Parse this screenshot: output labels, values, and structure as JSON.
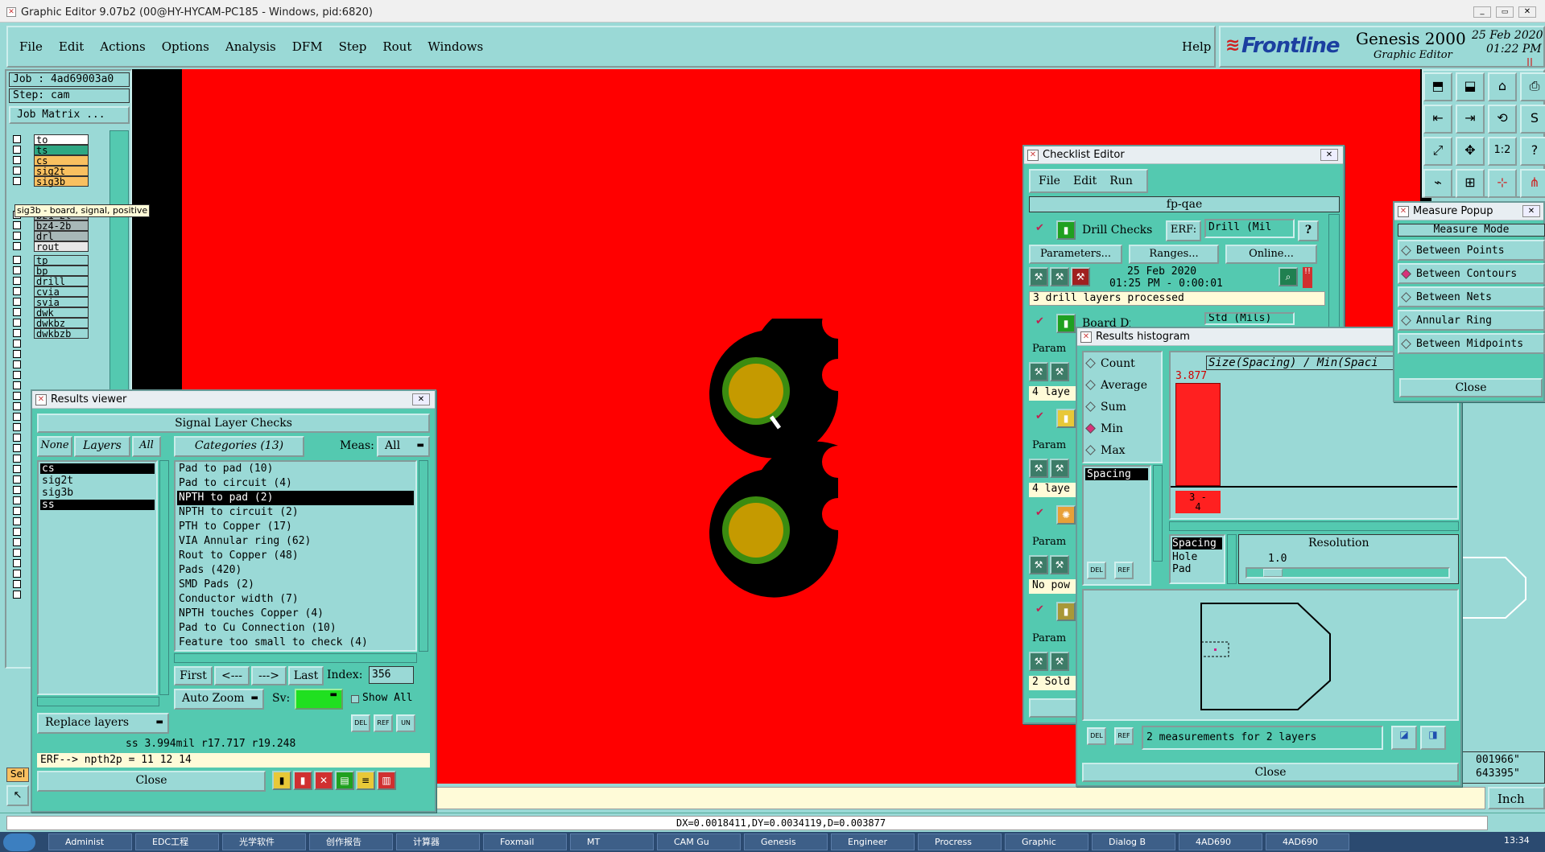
{
  "titlebar": {
    "title": "Graphic Editor 9.07b2 (00@HY-HYCAM-PC185 - Windows, pid:6820)"
  },
  "menu": {
    "items": [
      "File",
      "Edit",
      "Actions",
      "Options",
      "Analysis",
      "DFM",
      "Step",
      "Rout",
      "Windows"
    ],
    "help": "Help"
  },
  "brand": {
    "logo": "Frontline",
    "product": "Genesis 2000",
    "subtitle": "Graphic Editor",
    "date": "25 Feb 2020",
    "time": "01:22 PM"
  },
  "job": {
    "job_label": "Job : 4ad69003a0",
    "step_label": "Step: cam",
    "matrix_button": "Job Matrix ..."
  },
  "layers": [
    {
      "name": "to",
      "color": "#ffffff"
    },
    {
      "name": "ts",
      "color": "#2ea783"
    },
    {
      "name": "cs",
      "color": "#f9c060"
    },
    {
      "name": "sig2t",
      "color": "#f9c060"
    },
    {
      "name": "sig3b",
      "color": "#f9c060"
    },
    {
      "name": "bz1-2t",
      "color": "#a8b8b8"
    },
    {
      "name": "bz4-2b",
      "color": "#a8b8b8"
    },
    {
      "name": "drl",
      "color": "#a8b8b8"
    },
    {
      "name": "rout",
      "color": "#e8e8e8"
    },
    {
      "name": "tp",
      "color": "#9ad9d6"
    },
    {
      "name": "bp",
      "color": "#9ad9d6"
    },
    {
      "name": "drill",
      "color": "#9ad9d6"
    },
    {
      "name": "cvia",
      "color": "#9ad9d6"
    },
    {
      "name": "svia",
      "color": "#9ad9d6"
    },
    {
      "name": "dwk",
      "color": "#9ad9d6"
    },
    {
      "name": "dwkbz",
      "color": "#9ad9d6"
    },
    {
      "name": "dwkbzb",
      "color": "#9ad9d6"
    }
  ],
  "layer_tooltip": "sig3b - board, signal, positive",
  "results_viewer": {
    "title": "Results viewer",
    "header": "Signal Layer Checks",
    "none_btn": "None",
    "layers_btn": "Layers",
    "all_btn": "All",
    "categories_btn": "Categories (13)",
    "meas_label": "Meas:",
    "meas_value": "All",
    "layer_list": [
      "cs",
      "sig2t",
      "sig3b",
      "ss"
    ],
    "categories": [
      "Pad to pad (10)",
      "Pad to circuit (4)",
      "NPTH to pad (2)",
      "NPTH to circuit (2)",
      "PTH to Copper (17)",
      "VIA Annular ring (62)",
      "Rout to Copper (48)",
      "Pads (420)",
      "SMD Pads (2)",
      "Conductor width (7)",
      "NPTH touches Copper (4)",
      "Pad to Cu Connection (10)",
      "Feature too small to check (4)"
    ],
    "first_btn": "First",
    "prev_btn": "<---",
    "next_btn": "--->",
    "last_btn": "Last",
    "index_label": "Index:",
    "index_value": "356",
    "zoom_btn": "Auto Zoom",
    "sv_label": "Sv:",
    "show_all": "Show All",
    "replace_btn": "Replace layers",
    "status": "ss 3.994mil  r17.717  r19.248",
    "erf": "ERF--> npth2p = 11 12 14",
    "close": "Close"
  },
  "checklist": {
    "title": "Checklist Editor",
    "menu": [
      "File",
      "Edit",
      "Run"
    ],
    "name": "fp-qae",
    "drill": {
      "label": "Drill Checks",
      "erf_label": "ERF:",
      "erf_value": "Drill (Mil",
      "params": "Parameters...",
      "ranges": "Ranges...",
      "online": "Online...",
      "date": "25 Feb 2020",
      "time": "01:25 PM - 0:00:01",
      "status": "3 drill layers processed"
    },
    "board_drill": {
      "label": "Board Drill Ch",
      "erf_value": "Std (Mils)"
    },
    "partial": [
      "Param",
      "4 laye",
      "Param",
      "4 laye",
      "Param",
      "No pow",
      "Param",
      "2 Sold"
    ]
  },
  "histogram": {
    "title": "Results histogram",
    "modes": [
      {
        "label": "Count",
        "on": false
      },
      {
        "label": "Average",
        "on": false
      },
      {
        "label": "Sum",
        "on": false
      },
      {
        "label": "Min",
        "on": true
      },
      {
        "label": "Max",
        "on": false
      }
    ],
    "attr_list": [
      "Spacing"
    ],
    "chart_title": "Size(Spacing) / Min(Spaci",
    "bar_value": "3.877",
    "bin_label": "3 - 4",
    "list": [
      "Spacing",
      "Hole",
      "Pad"
    ],
    "resolution_label": "Resolution",
    "resolution_value": "1.0",
    "measurements": "2 measurements for 2 layers",
    "close": "Close"
  },
  "measure": {
    "title": "Measure Popup",
    "header": "Measure Mode",
    "options": [
      {
        "label": "Between Points",
        "on": false
      },
      {
        "label": "Between Contours",
        "on": true
      },
      {
        "label": "Between Nets",
        "on": false
      },
      {
        "label": "Annular Ring",
        "on": false
      },
      {
        "label": "Between Midpoints",
        "on": false
      }
    ],
    "close": "Close"
  },
  "coords": {
    "line1": "001966\"",
    "line2": "643395\"",
    "units": "Inch"
  },
  "status_bar": {
    "measure": "DX=0.0018411,DY=0.0034119,D=0.003877",
    "sel": "Sel"
  },
  "taskbar": {
    "clock": "13:34",
    "items": [
      "Administ",
      "EDC工程",
      "光学软件",
      "创作报告",
      "计算器",
      "Foxmail",
      "MT",
      "CAM Gu",
      "Genesis",
      "Engineer",
      "Procress",
      "Graphic",
      "Dialog B",
      "4AD690",
      "4AD690"
    ]
  }
}
